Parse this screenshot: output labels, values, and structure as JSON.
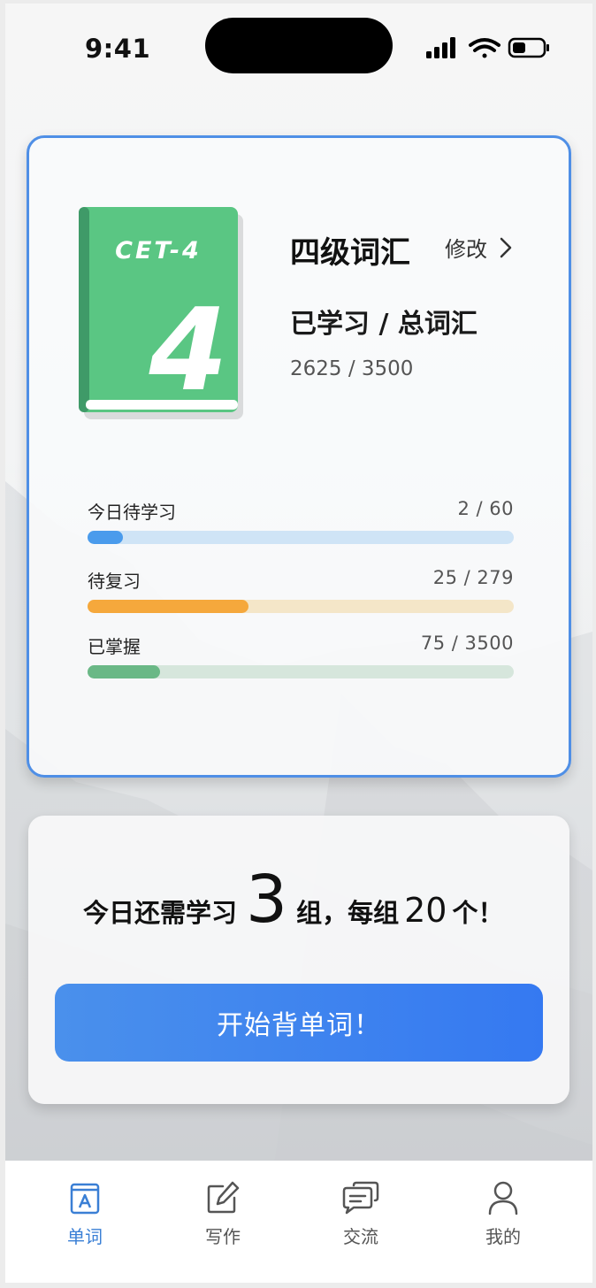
{
  "status_bar": {
    "time": "9:41"
  },
  "book": {
    "cover_label": "CET-4",
    "cover_number": "4",
    "title": "四级词汇",
    "edit_label": "修改",
    "learned_label": "已学习 / 总词汇",
    "learned_count": "2625 / 3500",
    "colors": {
      "cover": "#5ac683",
      "spine": "#3f9a68"
    }
  },
  "progress": [
    {
      "label": "今日待学习",
      "value": "2 / 60",
      "fraction": 0.083,
      "fill_color": "#4a9bec",
      "track_color": "#cfe4f6"
    },
    {
      "label": "待复习",
      "value": "25 / 279",
      "fraction": 0.378,
      "fill_color": "#f5a83c",
      "track_color": "#f4e6c8"
    },
    {
      "label": "已掌握",
      "value": "75 / 3500",
      "fraction": 0.17,
      "fill_color": "#6ab886",
      "track_color": "#d6e6dc"
    }
  ],
  "plan": {
    "prefix": "今日还需学习",
    "groups": "3",
    "middle": "组，每组",
    "per_group": "20",
    "suffix": "个！",
    "button_label": "开始背单词！"
  },
  "tabs": [
    {
      "label": "单词",
      "icon": "vocabulary-book-icon",
      "active": true
    },
    {
      "label": "写作",
      "icon": "edit-pencil-icon",
      "active": false
    },
    {
      "label": "交流",
      "icon": "chat-bubbles-icon",
      "active": false
    },
    {
      "label": "我的",
      "icon": "user-profile-icon",
      "active": false
    }
  ],
  "colors": {
    "accent": "#3a7fd5",
    "card_border": "#4f8fe6",
    "button": "#3b82ef"
  }
}
